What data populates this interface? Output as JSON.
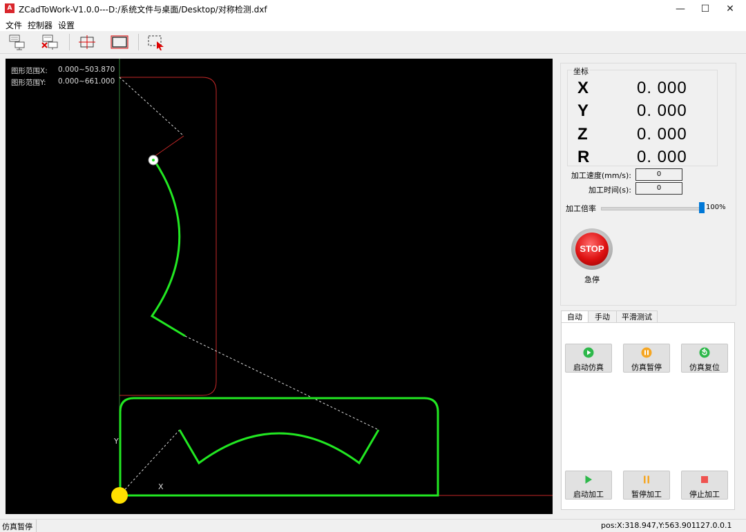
{
  "window": {
    "title": "ZCadToWork-V1.0.0---D:/系统文件与桌面/Desktop/对称检测.dxf",
    "icon_text": "A"
  },
  "menu": {
    "items": [
      "文件",
      "控制器",
      "设置"
    ]
  },
  "toolbar": {
    "icons": [
      "connect-icon",
      "disconnect-icon",
      "fit-view-icon",
      "frame-icon",
      "select-icon"
    ]
  },
  "canvas": {
    "range_x_label": "图形范围X:",
    "range_x_value": "0.000~503.870",
    "range_y_label": "图形范围Y:",
    "range_y_value": "0.000~661.000",
    "axis_y": "Y",
    "axis_x": "X"
  },
  "coords": {
    "legend": "坐标",
    "axes": [
      {
        "name": "X",
        "value": "0. 000"
      },
      {
        "name": "Y",
        "value": "0. 000"
      },
      {
        "name": "Z",
        "value": "0. 000"
      },
      {
        "name": "R",
        "value": "0. 000"
      }
    ]
  },
  "speed": {
    "label": "加工速度(mm/s):",
    "value": "0"
  },
  "time": {
    "label": "加工时间(s):",
    "value": "0"
  },
  "rate": {
    "label": "加工倍率",
    "value": "100%",
    "level": 1.0
  },
  "estop": {
    "text": "STOP",
    "label": "急停"
  },
  "tabs": [
    "自动",
    "手动",
    "平滑测试"
  ],
  "buttons": {
    "start_sim": "启动仿真",
    "pause_sim": "仿真暂停",
    "reset_sim": "仿真复位",
    "start_work": "启动加工",
    "pause_work": "暂停加工",
    "stop_work": "停止加工"
  },
  "status": {
    "left": "仿真暂停",
    "pos": "pos:X:318.947,Y:563.901",
    "ip": "127.0.0.1"
  },
  "colors": {
    "path": "#22e822",
    "boundary": "#c62828",
    "origin": "#ffe000",
    "accent": "#0078d7"
  }
}
